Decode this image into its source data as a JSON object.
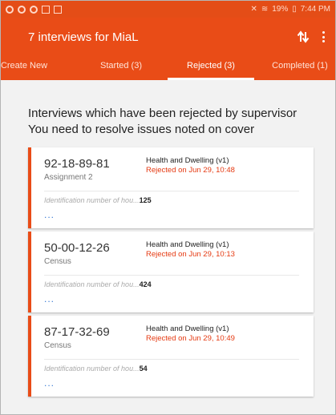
{
  "statusbar": {
    "right_text": "19%",
    "time": "7:44 PM"
  },
  "appbar": {
    "title": "7 interviews for MiaL"
  },
  "tabs": [
    {
      "label": "Create New",
      "active": false
    },
    {
      "label": "Started (3)",
      "active": false
    },
    {
      "label": "Rejected (3)",
      "active": true
    },
    {
      "label": "Completed (1)",
      "active": false
    }
  ],
  "intro": {
    "line1": "Interviews which have been rejected by supervisor",
    "line2": "You need to resolve issues noted on cover"
  },
  "cards": [
    {
      "id": "92-18-89-81",
      "subtitle": "Assignment 2",
      "survey": "Health and Dwelling (v1)",
      "status": "Rejected on Jun 29, 10:48",
      "field_label": "Identification number of hou...",
      "field_value": "125",
      "more": "..."
    },
    {
      "id": "50-00-12-26",
      "subtitle": "Census",
      "survey": "Health and Dwelling (v1)",
      "status": "Rejected on Jun 29, 10:13",
      "field_label": "Identification number of hou...",
      "field_value": "424",
      "more": "..."
    },
    {
      "id": "87-17-32-69",
      "subtitle": "Census",
      "survey": "Health and Dwelling (v1)",
      "status": "Rejected on Jun 29, 10:49",
      "field_label": "Identification number of hou...",
      "field_value": "54",
      "more": "..."
    }
  ],
  "colors": {
    "brand": "#e94c17",
    "rejected_text": "#e53a12",
    "link": "#3a7bd5"
  }
}
